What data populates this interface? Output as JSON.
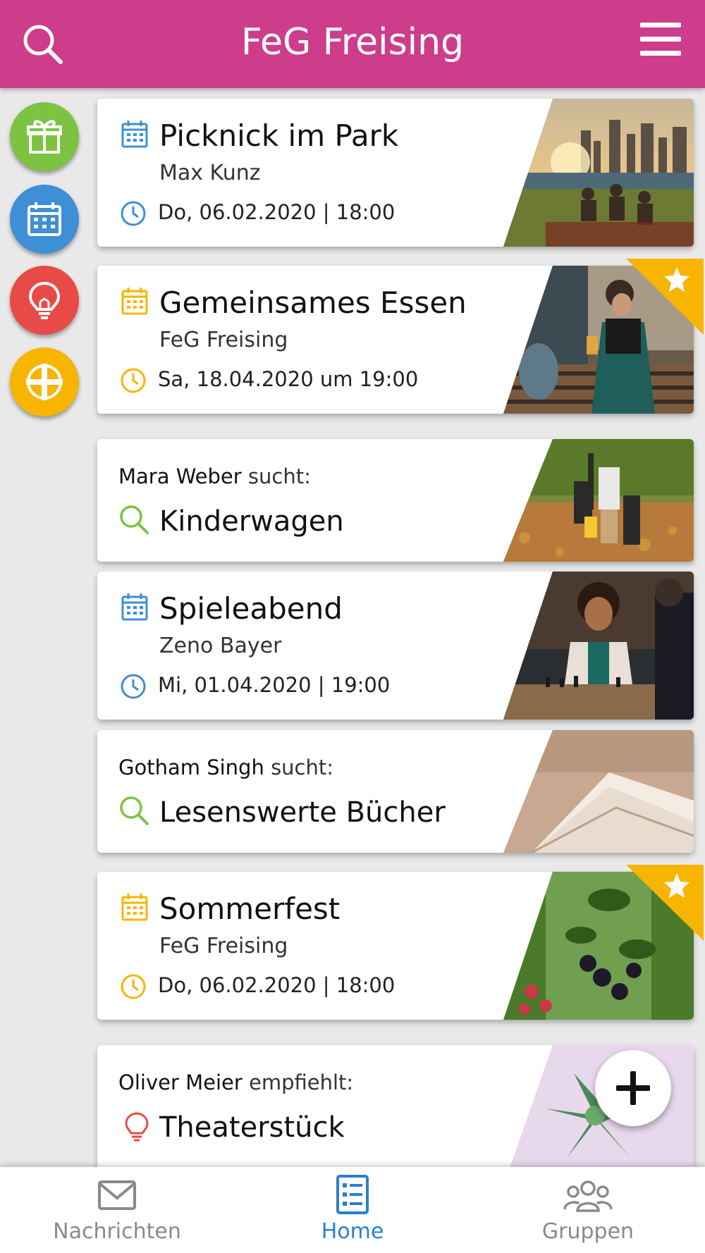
{
  "header": {
    "title": "FeG Freising"
  },
  "side_buttons": [
    {
      "icon": "gift-icon",
      "color": "#7cc342"
    },
    {
      "icon": "calendar-icon",
      "color": "#3d8fd6"
    },
    {
      "icon": "lightbulb-icon",
      "color": "#e84a48"
    },
    {
      "icon": "cross-icon",
      "color": "#f7b500"
    }
  ],
  "cards": {
    "picknick": {
      "title": "Picknick im Park",
      "organizer": "Max Kunz",
      "datetime": "Do, 06.02.2020 | 18:00",
      "accent": "#3d8fd6"
    },
    "essen": {
      "title": "Gemeinsames Essen",
      "organizer": "FeG Freising",
      "datetime": "Sa, 18.04.2020 um 19:00",
      "accent": "#f7b500",
      "featured": true
    },
    "kinderwagen": {
      "person": "Mara Weber",
      "verb": "sucht:",
      "title": "Kinderwagen"
    },
    "spieleabend": {
      "title": "Spieleabend",
      "organizer": "Zeno Bayer",
      "datetime": "Mi, 01.04.2020 | 19:00",
      "accent": "#3d8fd6"
    },
    "buecher": {
      "person": "Gotham Singh",
      "verb": "sucht:",
      "title": "Lesenswerte Bücher"
    },
    "sommerfest": {
      "title": "Sommerfest",
      "organizer": "FeG Freising",
      "datetime": "Do, 06.02.2020 | 18:00",
      "accent": "#f7b500",
      "featured": true
    },
    "theater": {
      "person": "Oliver Meier",
      "verb": "empfiehlt:",
      "title": "Theaterstück"
    }
  },
  "bottom_nav": {
    "messages": "Nachrichten",
    "home": "Home",
    "groups": "Gruppen"
  },
  "colors": {
    "brand": "#cd3d8b",
    "active": "#2b7fcf",
    "search_green": "#7cc342",
    "recommend_red": "#e84a48"
  }
}
